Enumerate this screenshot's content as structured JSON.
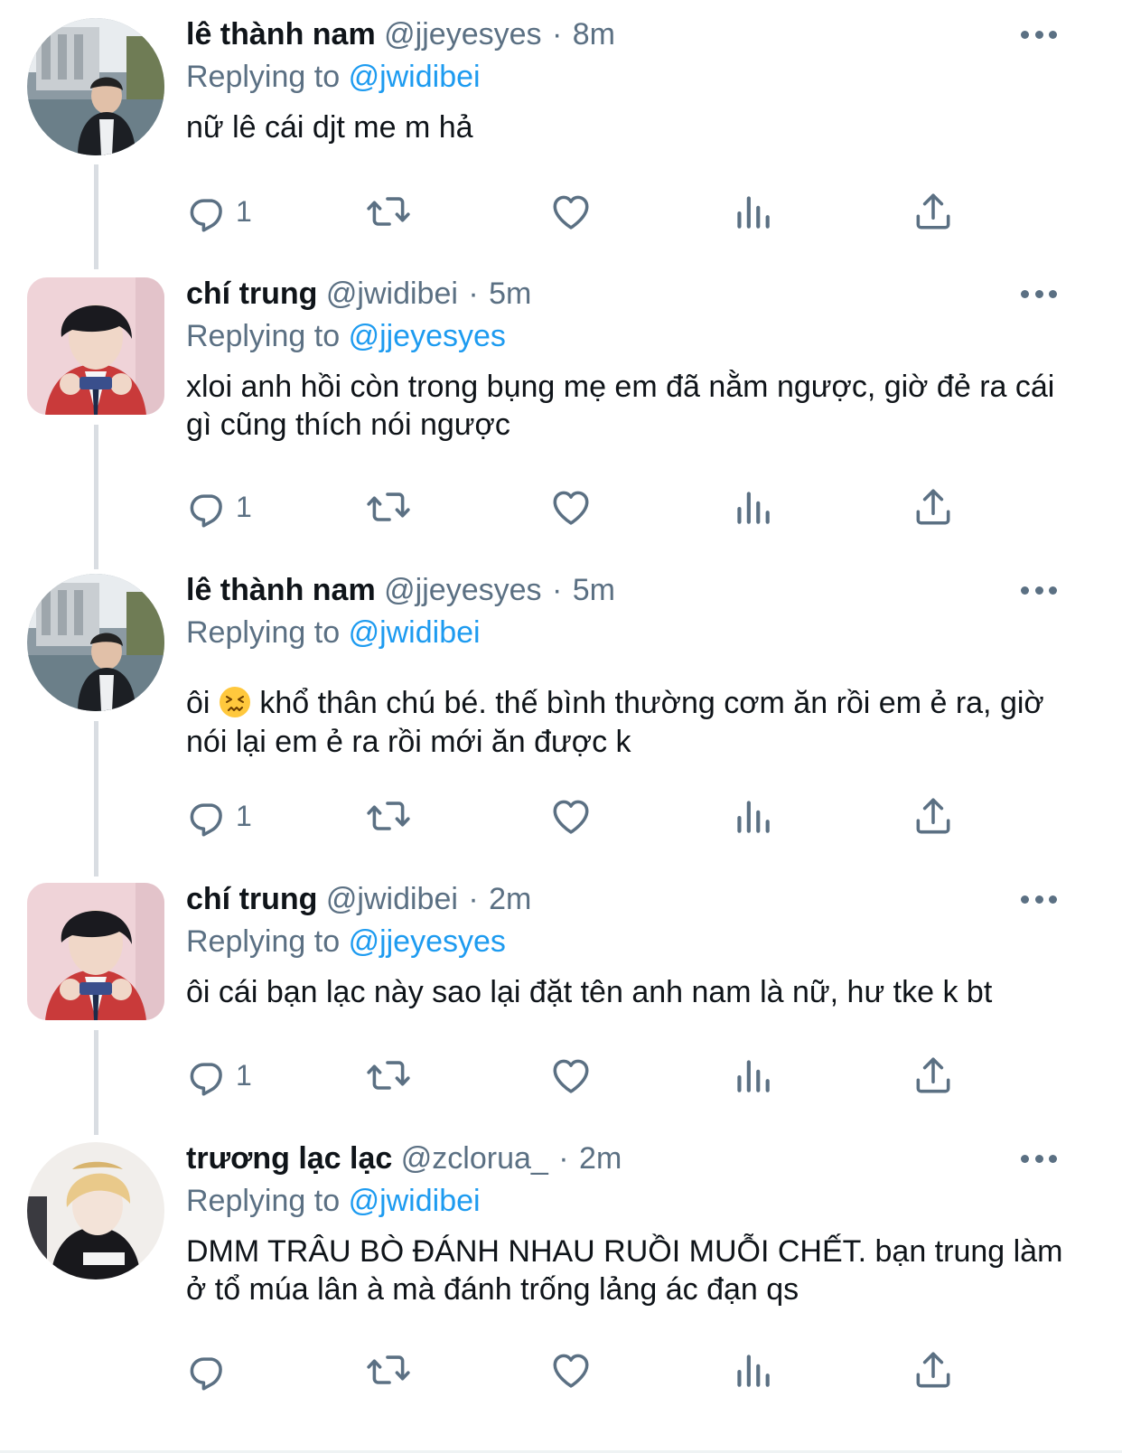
{
  "colors": {
    "accent": "#1d9bf0",
    "secondary_text": "#5b7083",
    "primary_text": "#0f1419",
    "thread_line": "#d9dde2"
  },
  "tweets": [
    {
      "name": "lê thành nam",
      "handle": "@jjeyesyes",
      "separator": "·",
      "time": "8m",
      "replying_prefix": "Replying to",
      "replying_to": "@jwidibei",
      "text": "nữ lê cái djt me m hả",
      "reply_count": "1",
      "avatar": "avatar-le-thanh-nam"
    },
    {
      "name": "chí trung",
      "handle": "@jwidibei",
      "separator": "·",
      "time": "5m",
      "replying_prefix": "Replying to",
      "replying_to": "@jjeyesyes",
      "text": "xloi anh hồi còn trong bụng mẹ em đã nằm ngược, giờ đẻ ra cái gì cũng thích nói ngược",
      "reply_count": "1",
      "avatar": "avatar-chi-trung"
    },
    {
      "name": "lê thành nam",
      "handle": "@jjeyesyes",
      "separator": "·",
      "time": "5m",
      "replying_prefix": "Replying to",
      "replying_to": "@jwidibei",
      "text_before_emoji": "ôi ",
      "emoji": "confounded-face-emoji",
      "text_after_emoji": " khổ thân chú bé. thế bình thường cơm ăn rồi em ẻ ra, giờ nói lại em ẻ ra rồi mới ăn được k",
      "reply_count": "1",
      "avatar": "avatar-le-thanh-nam"
    },
    {
      "name": "chí trung",
      "handle": "@jwidibei",
      "separator": "·",
      "time": "2m",
      "replying_prefix": "Replying to",
      "replying_to": "@jjeyesyes",
      "text": "ôi cái bạn lạc này sao lại đặt tên anh nam là nữ, hư tke k bt",
      "reply_count": "1",
      "avatar": "avatar-chi-trung"
    },
    {
      "name": "trương lạc lạc",
      "handle": "@zclorua_",
      "separator": "·",
      "time": "2m",
      "replying_prefix": "Replying to",
      "replying_to": "@jwidibei",
      "text": "DMM TRÂU BÒ ĐÁNH NHAU RUỒI MUỖI CHẾT. bạn trung làm ở tổ múa lân à mà đánh trống lảng ác đạn qs",
      "reply_count": "",
      "avatar": "avatar-truong-lac-lac"
    }
  ],
  "icons": [
    "reply-icon",
    "retweet-icon",
    "like-icon",
    "analytics-icon",
    "share-icon",
    "more-icon"
  ]
}
